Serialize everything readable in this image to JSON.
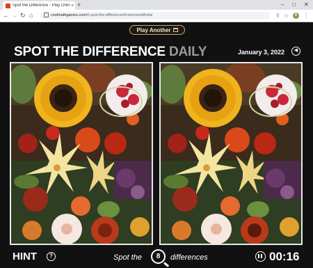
{
  "browser": {
    "tab_title": "Spot the Difference - Play Online",
    "tab_close": "×",
    "new_tab": "+",
    "url_host": "coolmathgames.com",
    "url_path": "/0-spot-the-difference#immersiveModal",
    "icons": [
      "back-arrow-icon",
      "forward-arrow-icon",
      "reload-icon",
      "home-icon",
      "lock-icon",
      "share-icon",
      "star-icon",
      "profile-avatar"
    ],
    "profile_initial": "B"
  },
  "game": {
    "play_another": "Play Another",
    "title_white": "SPOT THE DIFFERENCE ",
    "title_gray": "DAILY",
    "date": "January 3, 2022",
    "hint": "HINT",
    "hint_icon": "?",
    "spot_prefix": "Spot the",
    "differences_count": "8",
    "spot_suffix": "differences",
    "timer": "00:16",
    "colors": {
      "background": "#111111",
      "button_border": "#c9a86a",
      "title_white": "#ffffff",
      "title_gray": "#9b9b9b",
      "found_circle": "#cfd8a0"
    }
  }
}
